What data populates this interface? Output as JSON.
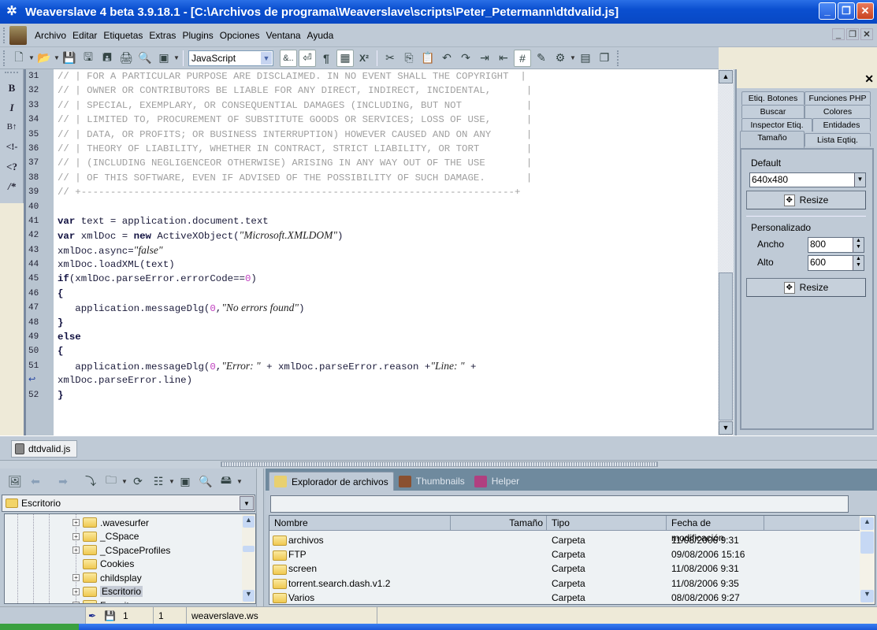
{
  "window": {
    "title": "Weaverslave 4 beta 3.9.18.1 - [C:\\Archivos de programa\\Weaverslave\\scripts\\Peter_Petermann\\dtdvalid.js]",
    "controls": {
      "minimize": "_",
      "restore": "❐",
      "close": "✕"
    }
  },
  "menu": {
    "items": [
      "Archivo",
      "Editar",
      "Etiquetas",
      "Extras",
      "Plugins",
      "Opciones",
      "Ventana",
      "Ayuda"
    ],
    "mdi_controls": {
      "minimize": "_",
      "restore": "❐",
      "close": "✕"
    }
  },
  "toolbar": {
    "language": "JavaScript",
    "buttons": [
      "new-file",
      "open-file",
      "save",
      "save-as",
      "save-all",
      "print",
      "print-preview",
      "preview",
      "special-chars",
      "word-wrap",
      "show-whitespace",
      "calculator",
      "superscript",
      "cut",
      "copy",
      "paste",
      "undo",
      "redo",
      "indent",
      "outdent",
      "line-numbers",
      "tag-editor",
      "plugins",
      "fullscreen",
      "windows"
    ],
    "special_chars_label": "&..",
    "pilcrow": "¶",
    "superscript_label": "X²"
  },
  "vertical_toolbar": {
    "items": [
      {
        "name": "bold",
        "label": "B"
      },
      {
        "name": "italic",
        "label": "I"
      },
      {
        "name": "bigger",
        "label": "B↑"
      },
      {
        "name": "html-comment",
        "label": "<!-"
      },
      {
        "name": "php-tag",
        "label": "<?"
      },
      {
        "name": "block-comment",
        "label": "/*"
      }
    ]
  },
  "editor": {
    "lines": [
      {
        "n": "31",
        "segments": [
          {
            "t": "// | FOR A PARTICULAR PURPOSE ARE DISCLAIMED. IN NO EVENT SHALL THE COPYRIGHT  |",
            "c": "cm"
          }
        ]
      },
      {
        "n": "32",
        "segments": [
          {
            "t": "// | OWNER OR CONTRIBUTORS BE LIABLE FOR ANY DIRECT, INDIRECT, INCIDENTAL,      |",
            "c": "cm"
          }
        ]
      },
      {
        "n": "33",
        "segments": [
          {
            "t": "// | SPECIAL, EXEMPLARY, OR CONSEQUENTIAL DAMAGES (INCLUDING, BUT NOT           |",
            "c": "cm"
          }
        ]
      },
      {
        "n": "34",
        "segments": [
          {
            "t": "// | LIMITED TO, PROCUREMENT OF SUBSTITUTE GOODS OR SERVICES; LOSS OF USE,      |",
            "c": "cm"
          }
        ]
      },
      {
        "n": "35",
        "segments": [
          {
            "t": "// | DATA, OR PROFITS; OR BUSINESS INTERRUPTION) HOWEVER CAUSED AND ON ANY      |",
            "c": "cm"
          }
        ]
      },
      {
        "n": "36",
        "segments": [
          {
            "t": "// | THEORY OF LIABILITY, WHETHER IN CONTRACT, STRICT LIABILITY, OR TORT        |",
            "c": "cm"
          }
        ]
      },
      {
        "n": "37",
        "segments": [
          {
            "t": "// | (INCLUDING NEGLIGENCEOR OTHERWISE) ARISING IN ANY WAY OUT OF THE USE       |",
            "c": "cm"
          }
        ]
      },
      {
        "n": "38",
        "segments": [
          {
            "t": "// | OF THIS SOFTWARE, EVEN IF ADVISED OF THE POSSIBILITY OF SUCH DAMAGE.       |",
            "c": "cm"
          }
        ]
      },
      {
        "n": "39",
        "segments": [
          {
            "t": "// +--------------------------------------------------------------------------+",
            "c": "cm"
          }
        ]
      },
      {
        "n": "40",
        "segments": []
      },
      {
        "n": "41",
        "segments": [
          {
            "t": "var",
            "c": "kw"
          },
          {
            "t": " text = application.document.text",
            "c": ""
          }
        ]
      },
      {
        "n": "42",
        "segments": [
          {
            "t": "var",
            "c": "kw"
          },
          {
            "t": " xmlDoc = ",
            "c": ""
          },
          {
            "t": "new",
            "c": "kw"
          },
          {
            "t": " ActiveXObject(",
            "c": ""
          },
          {
            "t": "\"Microsoft.XMLDOM\"",
            "c": "st"
          },
          {
            "t": ")",
            "c": ""
          }
        ]
      },
      {
        "n": "43",
        "segments": [
          {
            "t": "xmlDoc.async=",
            "c": ""
          },
          {
            "t": "\"false\"",
            "c": "st"
          }
        ]
      },
      {
        "n": "44",
        "segments": [
          {
            "t": "xmlDoc.loadXML(text)",
            "c": ""
          }
        ]
      },
      {
        "n": "45",
        "segments": [
          {
            "t": "if",
            "c": "kw"
          },
          {
            "t": "(xmlDoc.parseError.errorCode==",
            "c": ""
          },
          {
            "t": "0",
            "c": "num"
          },
          {
            "t": ")",
            "c": ""
          }
        ]
      },
      {
        "n": "46",
        "segments": [
          {
            "t": "{",
            "c": "kw"
          }
        ]
      },
      {
        "n": "47",
        "segments": [
          {
            "t": "   application.messageDlg(",
            "c": ""
          },
          {
            "t": "0",
            "c": "num"
          },
          {
            "t": ",",
            "c": ""
          },
          {
            "t": "\"No errors found\"",
            "c": "st"
          },
          {
            "t": ")",
            "c": ""
          }
        ]
      },
      {
        "n": "48",
        "segments": [
          {
            "t": "}",
            "c": "kw"
          }
        ]
      },
      {
        "n": "49",
        "segments": [
          {
            "t": "else",
            "c": "kw"
          }
        ]
      },
      {
        "n": "50",
        "segments": [
          {
            "t": "{",
            "c": "kw"
          }
        ]
      },
      {
        "n": "51",
        "segments": [
          {
            "t": "   application.messageDlg(",
            "c": ""
          },
          {
            "t": "0",
            "c": "num"
          },
          {
            "t": ",",
            "c": ""
          },
          {
            "t": "\"Error: \"",
            "c": "st"
          },
          {
            "t": " + xmlDoc.parseError.reason +",
            "c": ""
          },
          {
            "t": "\"Line: \"",
            "c": "st"
          },
          {
            "t": " +",
            "c": ""
          }
        ]
      },
      {
        "n": "↩",
        "segments": [
          {
            "t": "xmlDoc.parseError.line)",
            "c": ""
          }
        ]
      },
      {
        "n": "52",
        "segments": [
          {
            "t": "}",
            "c": "kw"
          }
        ]
      }
    ]
  },
  "right_panel": {
    "close": "✕",
    "tabs": [
      [
        "Etiq. Botones",
        "Funciones PHP"
      ],
      [
        "Buscar",
        "Colores"
      ],
      [
        "Inspector Etiq.",
        "Entidades"
      ],
      [
        "Tamaño",
        "Lista Eqtiq."
      ]
    ],
    "active_tab": "Tamaño",
    "default_label": "Default",
    "default_value": "640x480",
    "resize_label": "Resize",
    "custom_label": "Personalizado",
    "width_label": "Ancho",
    "width_value": "800",
    "height_label": "Alto",
    "height_value": "600"
  },
  "doc_tabs": [
    {
      "label": "dtdvalid.js",
      "active": true
    }
  ],
  "explorer": {
    "current_folder": "Escritorio",
    "tree": [
      {
        "label": ".wavesurfer",
        "expandable": true
      },
      {
        "label": "_CSpace",
        "expandable": true
      },
      {
        "label": "_CSpaceProfiles",
        "expandable": true
      },
      {
        "label": "Cookies",
        "expandable": false
      },
      {
        "label": "childsplay",
        "expandable": true
      },
      {
        "label": "Escritorio",
        "expandable": true,
        "selected": true
      },
      {
        "label": "Favoritos",
        "expandable": true
      }
    ]
  },
  "file_browser": {
    "tabs": [
      {
        "label": "Explorador de archivos",
        "active": true
      },
      {
        "label": "Thumbnails",
        "active": false
      },
      {
        "label": "Helper",
        "active": false
      }
    ],
    "path_value": "",
    "columns": [
      "Nombre",
      "Tamaño",
      "Tipo",
      "Fecha de modificación"
    ],
    "rows": [
      {
        "name": "archivos",
        "size": "",
        "type": "Carpeta",
        "modified": "11/08/2006 9:31"
      },
      {
        "name": "FTP",
        "size": "",
        "type": "Carpeta",
        "modified": "09/08/2006 15:16"
      },
      {
        "name": "screen",
        "size": "",
        "type": "Carpeta",
        "modified": "11/08/2006 9:31"
      },
      {
        "name": "torrent.search.dash.v1.2",
        "size": "",
        "type": "Carpeta",
        "modified": "11/08/2006 9:35"
      },
      {
        "name": "Varios",
        "size": "",
        "type": "Carpeta",
        "modified": "08/08/2006 9:27"
      }
    ]
  },
  "status": {
    "line": "1",
    "column": "1",
    "workspace": "weaverslave.ws"
  }
}
